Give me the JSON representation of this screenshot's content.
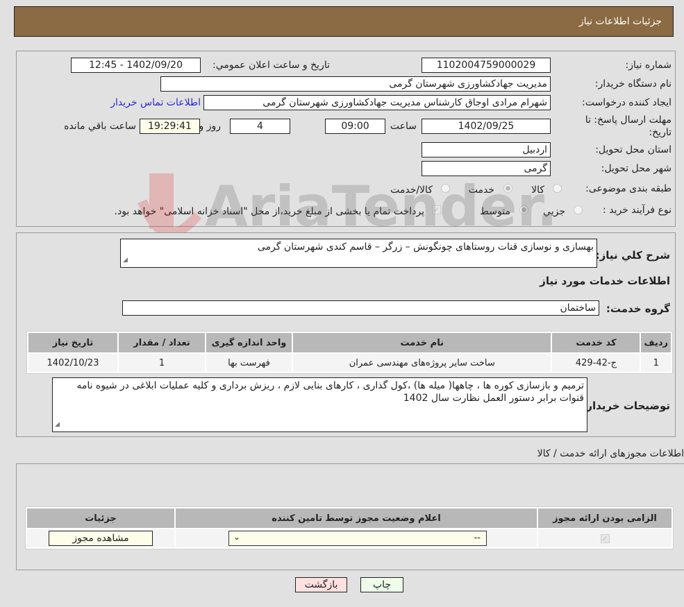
{
  "header": {
    "title": "جزئیات اطلاعات نیاز"
  },
  "info": {
    "need_number_label": "شماره نیاز:",
    "need_number": "1102004759000029",
    "announce_label": "تاریخ و ساعت اعلان عمومي:",
    "announce_value": "1402/09/20 - 12:45",
    "buyer_org_label": "نام دستگاه خریدار:",
    "buyer_org": "مدیریت جهادکشاورزی شهرستان گرمی",
    "requester_label": "ایجاد کننده درخواست:",
    "requester": "شهرام  مرادی اوجاق کارشناس مدیریت جهادکشاورزی شهرستان گرمی",
    "contact_link": "اطلاعات تماس خریدار",
    "deadline_label_1": "مهلت ارسال پاسخ: تا",
    "deadline_label_2": "تاریخ:",
    "deadline_date": "1402/09/25",
    "time_label": "ساعت",
    "deadline_time": "09:00",
    "days_value": "4",
    "days_label": "روز و",
    "remaining_time": "19:29:41",
    "remaining_label": "ساعت باقي مانده",
    "province_label": "استان محل تحویل:",
    "province": "اردبیل",
    "city_label": "شهر محل تحویل:",
    "city": "گرمی",
    "category_label": "طبقه بندی موضوعی:",
    "category_options": [
      {
        "label": "کالا",
        "selected": false
      },
      {
        "label": "خدمت",
        "selected": true
      },
      {
        "label": "کالا/خدمت",
        "selected": false
      }
    ],
    "process_label": "نوع فرآیند خرید :",
    "process_options": [
      {
        "label": "جزيي",
        "selected": false
      },
      {
        "label": "متوسط",
        "selected": true
      }
    ],
    "treasury_note": "پرداخت تمام یا بخشی از مبلغ خرید،از محل \"اسناد خزانه اسلامی\" خواهد بود.",
    "treasury_checked": true
  },
  "services": {
    "summary_label": "شرح کلي نیاز:",
    "summary": "بهسازی و نوسازی قنات روستاهای چونگونش – زرگر – قاسم کندی شهرستان گرمی",
    "section_title": "اطلاعات خدمات مورد نیاز",
    "group_label": "گروه خدمت:",
    "group_value": "ساختمان",
    "table": {
      "headers": [
        "ردیف",
        "کد خدمت",
        "نام خدمت",
        "واحد اندازه گیری",
        "تعداد / مقدار",
        "تاریخ نیاز"
      ],
      "rows": [
        [
          "1",
          "ج-42-429",
          "ساخت سایر پروژه‌های مهندسی عمران",
          "فهرست بها",
          "1",
          "1402/10/23"
        ]
      ]
    },
    "buyer_notes_label": "توضیحات خریدار:",
    "buyer_notes": "ترمیم و بازسازی کوره ها ، چاهها( میله ها) ،کول گذاری ، کارهای بنایی لازم ، ریزش برداری  و کلیه عملیات ابلاغی در شیوه نامه قنوات برابر دستور العمل نظارت سال 1402"
  },
  "permits": {
    "section_title": "اطلاعات مجوزهای ارائه خدمت / کالا",
    "headers": [
      "الزامی بودن ارائه مجوز",
      "اعلام وضعیت مجوز توسط تامین کننده",
      "جزئیات"
    ],
    "row": {
      "required_checked": true,
      "status_value": "--",
      "details_button": "مشاهده مجوز"
    }
  },
  "footer": {
    "print_button": "چاپ",
    "back_button": "بازگشت"
  },
  "watermark": {
    "text": "AriaTender.net"
  }
}
